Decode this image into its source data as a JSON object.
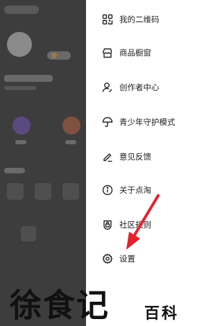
{
  "menu": {
    "items": [
      {
        "label": "我的二维码",
        "icon": "qr-code-icon"
      },
      {
        "label": "商品橱窗",
        "icon": "storefront-icon"
      },
      {
        "label": "创作者中心",
        "icon": "creator-person-icon"
      },
      {
        "label": "青少年守护模式",
        "icon": "umbrella-icon"
      },
      {
        "label": "意见反馈",
        "icon": "pencil-feedback-icon"
      },
      {
        "label": "关于点淘",
        "icon": "info-icon"
      },
      {
        "label": "社区规则",
        "icon": "shield-lock-icon"
      },
      {
        "label": "设置",
        "icon": "gear-icon"
      }
    ]
  },
  "annotation": {
    "color": "#e8202a"
  },
  "watermark": {
    "main": "徐食记",
    "sub": "百科"
  }
}
